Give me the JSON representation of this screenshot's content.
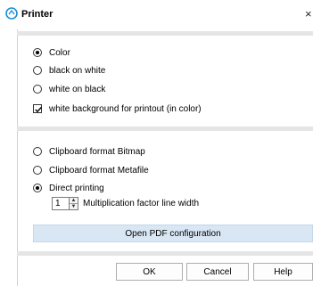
{
  "window": {
    "title": "Printer",
    "close_glyph": "×"
  },
  "options": {
    "color": "Color",
    "black_on_white": "black on white",
    "white_on_black": "white on black",
    "white_background": "white background for printout (in color)",
    "clipboard_bitmap": "Clipboard format Bitmap",
    "clipboard_metafile": "Clipboard format Metafile",
    "direct_printing": "Direct printing"
  },
  "multiplication": {
    "value": "1",
    "label": "Multiplication factor line width"
  },
  "buttons": {
    "open_pdf": "Open PDF configuration",
    "ok": "OK",
    "cancel": "Cancel",
    "help": "Help"
  },
  "colors": {
    "accent": "#1a8fd6",
    "pdf_button_bg": "#d9e7f4",
    "separator": "#e5e5e5"
  }
}
